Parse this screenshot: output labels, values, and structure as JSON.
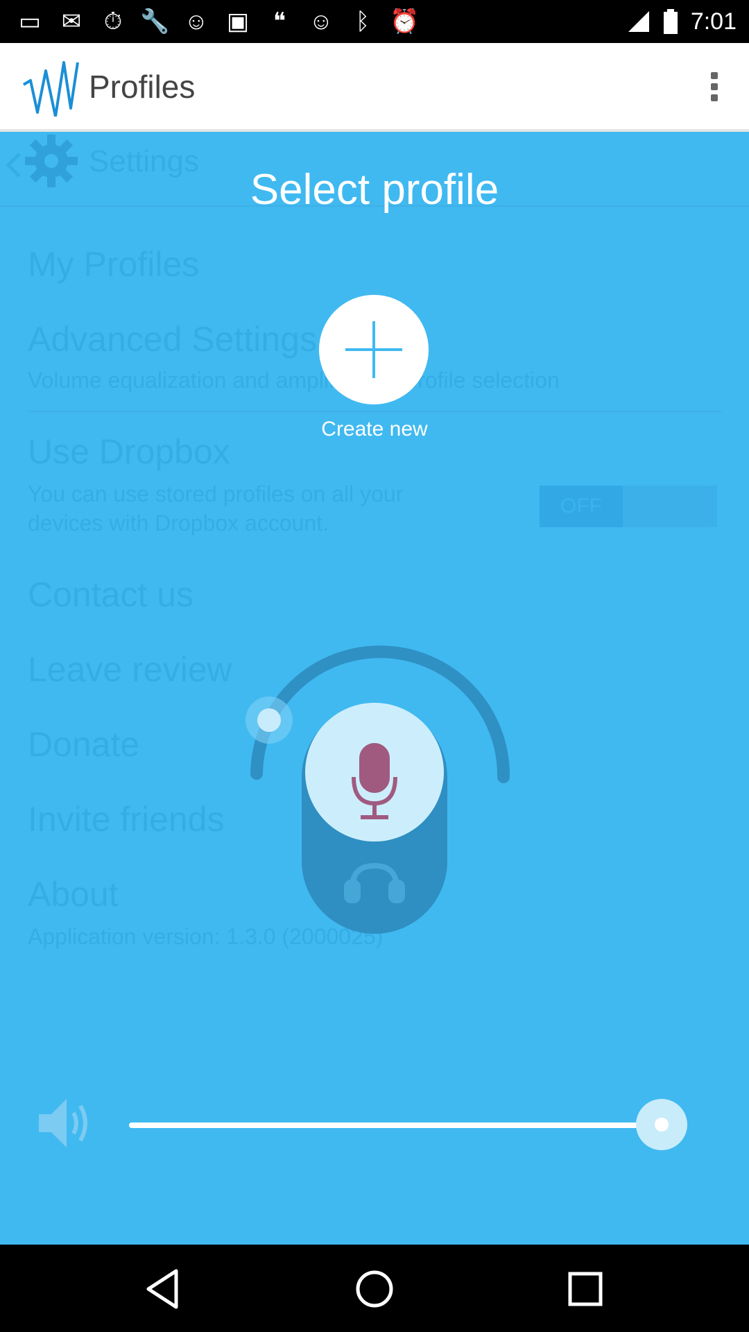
{
  "status_bar": {
    "time": "7:01",
    "left_icons": [
      "message-icon",
      "mail-icon",
      "timer-icon",
      "wrench-icon",
      "smiley-icon",
      "qt-icon",
      "quote-icon",
      "smiley-icon",
      "bluetooth-icon",
      "alarm-icon",
      "signal-icon",
      "battery-icon"
    ]
  },
  "app_bar": {
    "title": "Profiles"
  },
  "background_settings": {
    "header": "Settings",
    "my_profiles": "My Profiles",
    "advanced_title": "Advanced Settings",
    "advanced_sub": "Volume equalization and amplification profile selection",
    "dropbox_title": "Use Dropbox",
    "dropbox_sub_1": "You can use stored profiles on all your",
    "dropbox_sub_2": "devices with Dropbox account.",
    "toggle": "OFF",
    "contact": "Contact us",
    "review": "Leave review",
    "donate": "Donate",
    "invite": "Invite friends",
    "about": "About",
    "version": "Application version: 1.3.0 (2000025)"
  },
  "dialog": {
    "title": "Select profile",
    "create_label": "Create new"
  },
  "volume": {
    "level": 0.96
  },
  "colors": {
    "accent": "#40b9f0",
    "mic": "#a05a80"
  }
}
